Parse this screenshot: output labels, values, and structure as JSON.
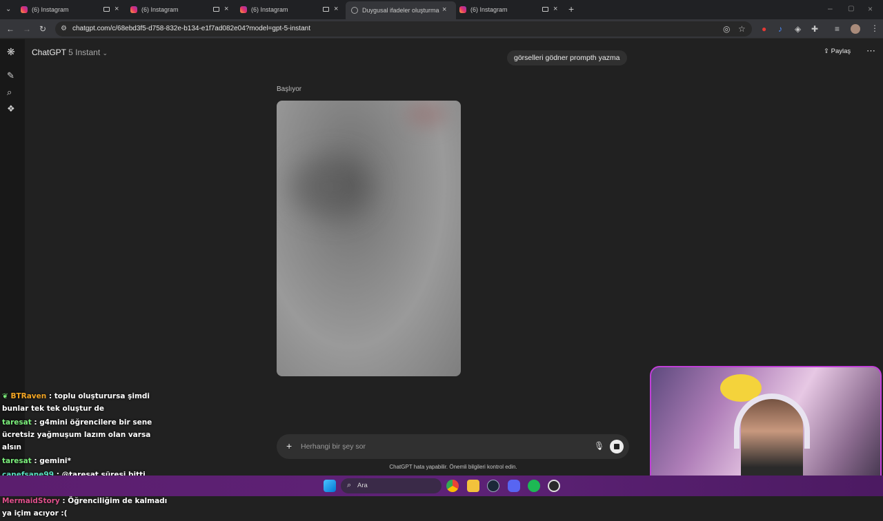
{
  "browser": {
    "tabs": [
      {
        "title": "(6) Instagram",
        "active": false
      },
      {
        "title": "(6) Instagram",
        "active": false
      },
      {
        "title": "(6) Instagram",
        "active": false
      },
      {
        "title": "Duygusal ifadeler oluşturma",
        "active": true
      },
      {
        "title": "(6) Instagram",
        "active": false
      }
    ],
    "url": "chatgpt.com/c/68ebd3f5-d758-832e-b134-e1f7ad082e04?model=gpt-5-instant"
  },
  "chatgpt": {
    "model_name": "ChatGPT",
    "model_version": "5 Instant",
    "share_label": "Paylaş",
    "user_message": "görselleri gödner prompth yazma",
    "status_label": "Başlıyor",
    "composer_placeholder": "Herhangi bir şey sor",
    "disclaimer": "ChatGPT hata yapabilir. Önemli bilgileri kontrol edin."
  },
  "stream_chat": [
    {
      "user": "BTRaven",
      "user_color": "#f5a623",
      "text": ": toplu oluşturursa şimdi bunlar tek tek oluştur de"
    },
    {
      "user": "taresat",
      "user_color": "#7cf07c",
      "text": ": g4mini öğrencilere bir sene ücretsiz yağmuşum lazım olan varsa alsın"
    },
    {
      "user": "taresat",
      "user_color": "#7cf07c",
      "text": ": gemini*"
    },
    {
      "user": "canefsane99",
      "user_color": "#58e0c0",
      "text": ": @taresat süresi bitti galiba"
    },
    {
      "user": "MermaidStory",
      "user_color": "#e0508c",
      "text": ": Öğrenciliğim de kalmadı ya içim acıyor :("
    }
  ],
  "taskbar": {
    "search_label": "Ara"
  },
  "colors": {
    "background": "#212121",
    "accent_webcam_border": "#c13fd8",
    "taskbar": "#5e2277"
  }
}
